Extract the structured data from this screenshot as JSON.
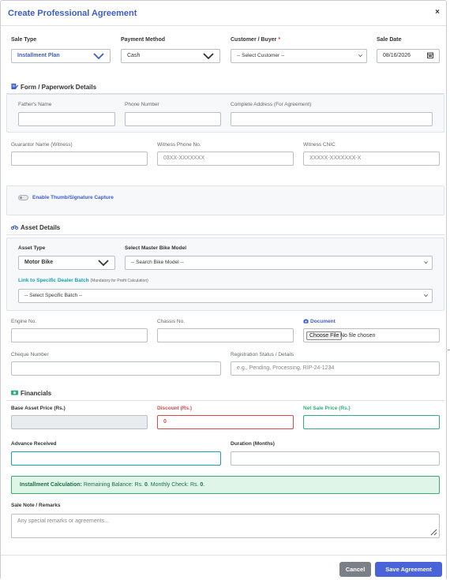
{
  "modal": {
    "title": "Create Professional Agreement",
    "close": "×"
  },
  "sale": {
    "sale_type_label": "Sale Type",
    "sale_type_value": "Installment Plan",
    "payment_method_label": "Payment Method",
    "payment_method_value": "Cash",
    "customer_label": "Customer / Buyer",
    "customer_required": "*",
    "customer_placeholder": "-- Select Customer --",
    "sale_date_label": "Sale Date",
    "sale_date_value": "08/16/2026"
  },
  "paperwork": {
    "title": "Form / Paperwork Details",
    "fathers_name_label": "Father's Name",
    "phone_label": "Phone Number",
    "address_label": "Complete Address (For Agreement)",
    "guarantor_label": "Guarantor Name (Witness)",
    "witness_phone_label": "Witness Phone No.",
    "witness_phone_placeholder": "03XX-XXXXXXX",
    "witness_cnic_label": "Witness CNIC",
    "witness_cnic_placeholder": "XXXXX-XXXXXXX-X"
  },
  "thumb": {
    "label": "Enable Thumb/Signature Capture"
  },
  "asset": {
    "title": "Asset Details",
    "asset_type_label": "Asset Type",
    "asset_type_value": "Motor Bike",
    "master_model_label": "Select Master Bike Model",
    "master_model_placeholder": "-- Search Bike Model --",
    "batch_link_label": "Link to Specific Dealer Batch",
    "batch_note": "(Mandatory for Profit Calculation)",
    "batch_placeholder": "-- Select Specific Batch --",
    "engine_label": "Engine No.",
    "chassis_label": "Chassis No.",
    "document_label": "Document",
    "choose_file": "Choose File",
    "no_file": "No file chosen",
    "cheque_label": "Cheque Number",
    "registration_label": "Registration Status / Details",
    "registration_placeholder": "e.g., Pending, Processing, RIP-24-1234"
  },
  "financials": {
    "title": "Financials",
    "base_price_label": "Base Asset Price (Rs.)",
    "discount_label": "Discount (Rs.)",
    "discount_value": "0",
    "net_price_label": "Net Sale Price (Rs.)",
    "advance_label": "Advance Received",
    "duration_label": "Duration (Months)",
    "calc_heading": "Installment Calculation:",
    "calc_balance_text": "Remaining Balance: Rs.",
    "calc_balance_value": "0",
    "calc_monthly_text": ". Monthly Check: Rs.",
    "calc_monthly_value": "0",
    "calc_end": ".",
    "note_label": "Sale Note / Remarks",
    "note_placeholder": "Any special remarks or agreements..."
  },
  "footer": {
    "cancel": "Cancel",
    "save": "Save Agreement"
  },
  "colors": {
    "brand_blue": "#3d5dc7",
    "primary_button": "#4a63d8",
    "cancel_button": "#7b7f86",
    "danger": "#d94848",
    "success": "#2fb07a",
    "link_cyan": "#17a2b8"
  }
}
